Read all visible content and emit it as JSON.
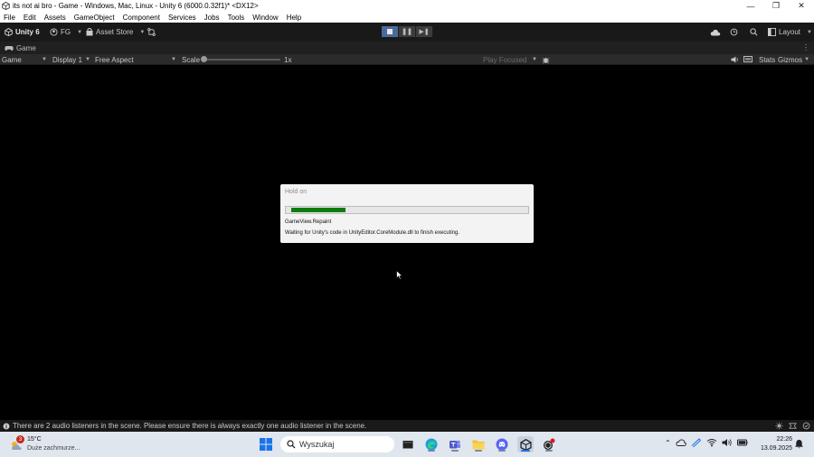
{
  "window": {
    "title": "its not ai bro - Game - Windows, Mac, Linux - Unity 6 (6000.0.32f1)* <DX12>",
    "controls": [
      "minimize-icon",
      "restore-icon",
      "close-icon"
    ]
  },
  "menu": [
    "File",
    "Edit",
    "Assets",
    "GameObject",
    "Component",
    "Services",
    "Jobs",
    "Tools",
    "Window",
    "Help"
  ],
  "toolbar": {
    "unity_label": "Unity 6",
    "account_label": "FG",
    "asset_store_label": "Asset Store",
    "layout_label": "Layout"
  },
  "tab": {
    "game_label": "Game"
  },
  "game_toolbar": {
    "view_label": "Game",
    "display_label": "Display 1",
    "aspect_label": "Free Aspect",
    "scale_label": "Scale",
    "scale_value": "1x",
    "play_focused_label": "Play Focused",
    "stats_label": "Stats",
    "gizmos_label": "Gizmos"
  },
  "dialog": {
    "title": "Hold on",
    "progress": 0.23,
    "progress_color": "#0f7b0f",
    "line1": "GameView.Repaint",
    "line2": "Waiting for Unity's code in UnityEditor.CoreModule.dll to finish executing."
  },
  "status": {
    "message": "There are 2 audio listeners in the scene. Please ensure there is always exactly one audio listener in the scene."
  },
  "taskbar": {
    "weather_temp": "15°C",
    "weather_desc": "Duże zachmurze...",
    "weather_badge": "3",
    "search_placeholder": "Wyszukaj",
    "time": "22:26",
    "date": "13.09.2025"
  },
  "colors": {
    "accent": "#4a6a9a",
    "toolbar_bg": "#191919",
    "taskbar_bg": "#dfe6ee"
  }
}
